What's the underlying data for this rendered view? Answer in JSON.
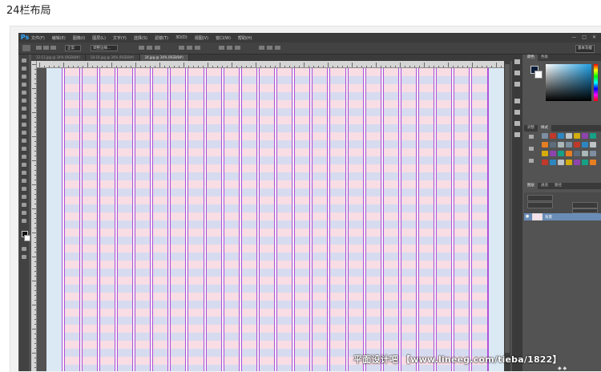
{
  "page_heading": "24栏布局",
  "photoshop": {
    "logo": "Ps",
    "menu": [
      "文件(F)",
      "编辑(E)",
      "图像(I)",
      "图层(L)",
      "文字(Y)",
      "选择(S)",
      "滤镜(T)",
      "3D(D)",
      "视图(V)",
      "窗口(W)",
      "帮助(H)"
    ],
    "window_controls": [
      "—",
      "□",
      "✕"
    ],
    "options": {
      "style_select": "正常",
      "refine_button": "调整边缘...",
      "workspace": "基本功能"
    },
    "tabs": [
      {
        "label": "12-12.jpg @ 34% (RGB/8#)",
        "active": false
      },
      {
        "label": "18-10.jpg @ 34% (RGB/8#)",
        "active": false
      },
      {
        "label": "24.jpg @ 34% (RGB/8#)",
        "active": true
      }
    ],
    "panels": {
      "color_tabs": [
        "颜色",
        "色板"
      ],
      "adjust_tabs": [
        "调整",
        "样式"
      ],
      "layers_tabs": [
        "图层",
        "通道",
        "路径"
      ],
      "layer": {
        "name": "背景",
        "visible_icon": "eye-icon"
      }
    },
    "canvas": {
      "columns": 24,
      "column_color": "#dbe9f5",
      "stripe_pink": "#f8dde5",
      "stripe_blue": "#d7dbef",
      "guide_color": "#b04fd8"
    },
    "icons": {
      "fg_bg_swatch": "fg-bg-color-icon",
      "eye": "eye-icon"
    }
  },
  "watermark": "平面设计吧 【www.lineeg.com/tieba/1822】"
}
